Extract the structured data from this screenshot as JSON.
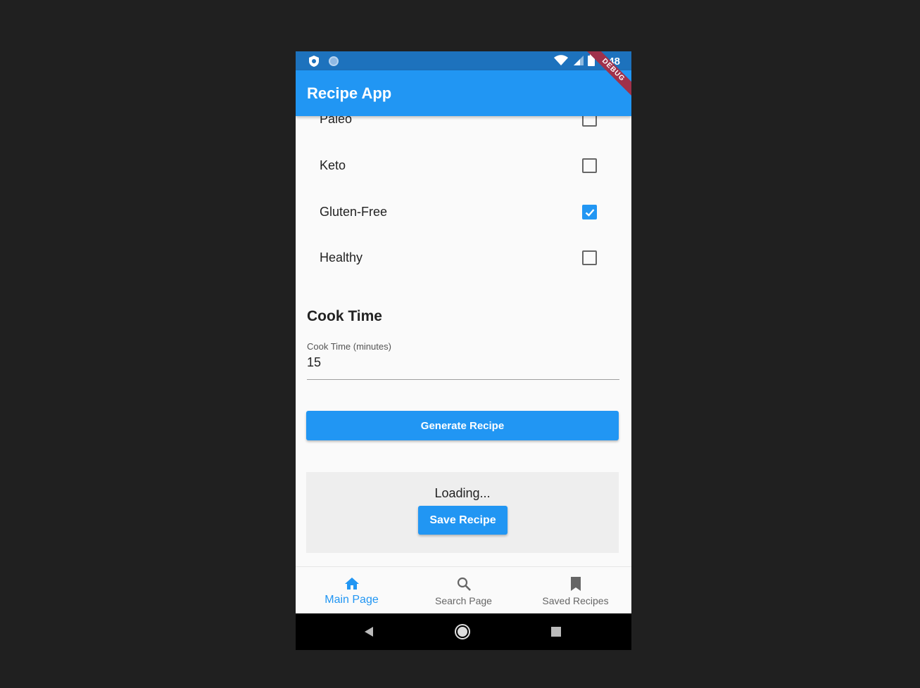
{
  "status_bar": {
    "time": "4:48"
  },
  "app_bar": {
    "title": "Recipe App",
    "debug_banner": "DEBUG"
  },
  "diet_options": [
    {
      "label": "Paleo",
      "checked": false
    },
    {
      "label": "Keto",
      "checked": false
    },
    {
      "label": "Gluten-Free",
      "checked": true
    },
    {
      "label": "Healthy",
      "checked": false
    }
  ],
  "cook_time": {
    "section_title": "Cook Time",
    "field_label": "Cook Time (minutes)",
    "value": "15"
  },
  "generate_button": "Generate Recipe",
  "result": {
    "status_text": "Loading...",
    "save_button": "Save Recipe"
  },
  "bottom_nav": {
    "items": [
      {
        "label": "Main Page",
        "icon": "home-icon",
        "active": true
      },
      {
        "label": "Search Page",
        "icon": "search-icon",
        "active": false
      },
      {
        "label": "Saved Recipes",
        "icon": "bookmark-icon",
        "active": false
      }
    ]
  },
  "colors": {
    "primary": "#2196f3",
    "status_bar": "#1d72bd",
    "background": "#fafafa",
    "result_box": "#eeeeee",
    "debug_banner": "#a0314a"
  }
}
